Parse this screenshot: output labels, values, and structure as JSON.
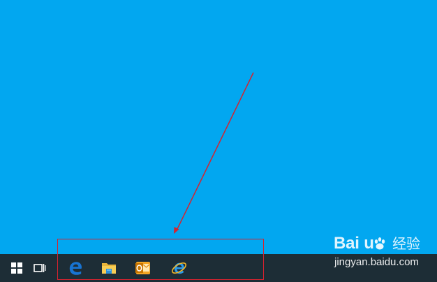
{
  "desktop": {
    "background_color": "#02a7f0"
  },
  "taskbar": {
    "background_color": "#1d2d36",
    "items": [
      {
        "name": "start",
        "icon": "windows-logo-icon"
      },
      {
        "name": "task-view",
        "icon": "task-view-icon"
      },
      {
        "name": "edge",
        "icon": "edge-browser-icon"
      },
      {
        "name": "file-explorer",
        "icon": "folder-icon"
      },
      {
        "name": "outlook",
        "icon": "outlook-icon"
      },
      {
        "name": "internet-explorer",
        "icon": "internet-explorer-icon"
      }
    ]
  },
  "annotation": {
    "arrow_color": "#d5232f",
    "box_color": "#d5232f"
  },
  "watermark": {
    "brand_text": "Bai  u",
    "paw_icon": "baidu-paw-icon",
    "cn_text": "经验",
    "domain_text": "jingyan.baidu.com"
  }
}
